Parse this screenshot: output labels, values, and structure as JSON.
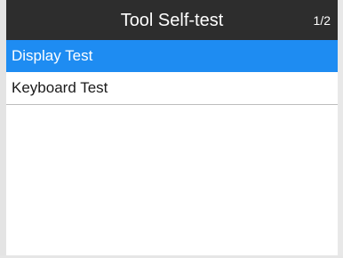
{
  "header": {
    "title": "Tool Self-test",
    "page_indicator": "1/2"
  },
  "menu": {
    "selected_index": 0,
    "items": [
      {
        "label": "Display Test"
      },
      {
        "label": "Keyboard Test"
      }
    ]
  },
  "colors": {
    "title_bar": "#2d2d2d",
    "selection": "#1e8cf2",
    "text": "#1a1a1a",
    "background": "#ffffff"
  }
}
